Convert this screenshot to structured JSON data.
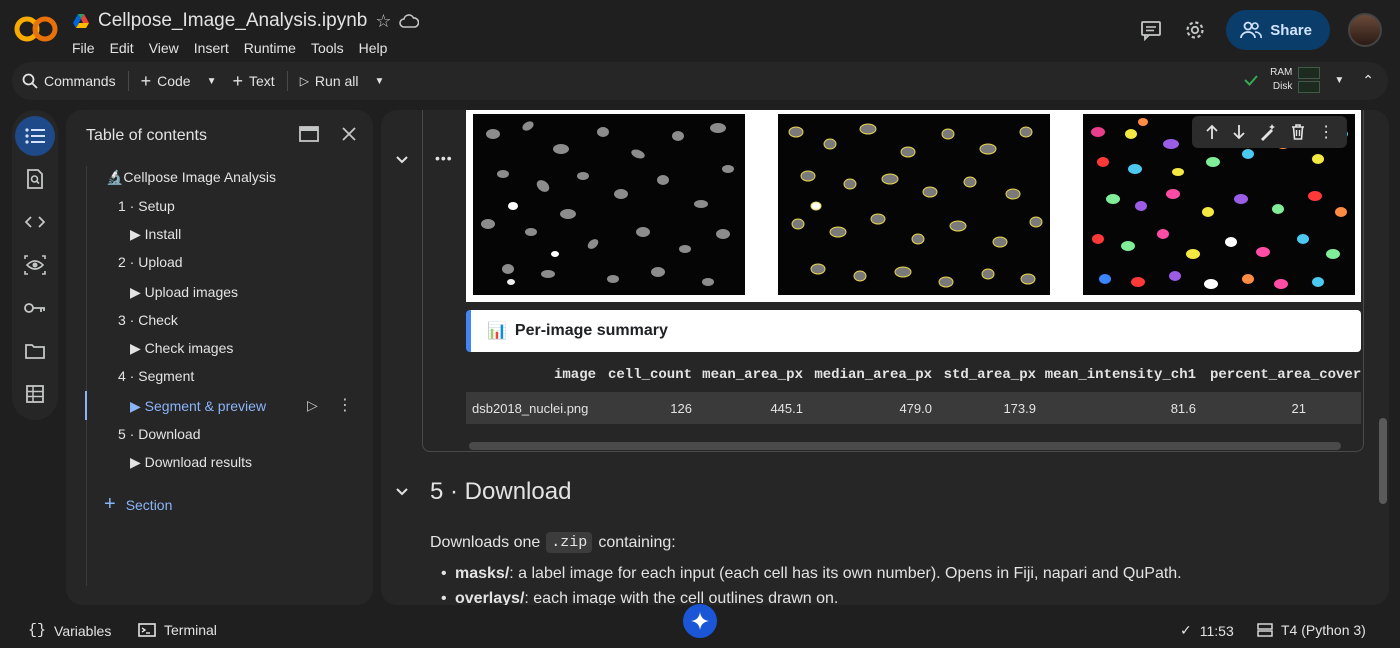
{
  "header": {
    "notebook_title": "Cellpose_Image_Analysis.ipynb",
    "menu": [
      "File",
      "Edit",
      "View",
      "Insert",
      "Runtime",
      "Tools",
      "Help"
    ],
    "share_label": "Share"
  },
  "toolbar": {
    "commands_label": "Commands",
    "code_label": "Code",
    "text_label": "Text",
    "run_all_label": "Run all",
    "ram_label": "RAM",
    "disk_label": "Disk"
  },
  "toc": {
    "title": "Table of contents",
    "items": [
      {
        "label": "🔬Cellpose Image Analysis",
        "level": 0
      },
      {
        "label": "1 · Setup",
        "level": 1
      },
      {
        "label": "▶ Install",
        "level": 2
      },
      {
        "label": "2 · Upload",
        "level": 1
      },
      {
        "label": "▶ Upload images",
        "level": 2
      },
      {
        "label": "3 · Check",
        "level": 1
      },
      {
        "label": "▶ Check images",
        "level": 2
      },
      {
        "label": "4 · Segment",
        "level": 1
      },
      {
        "label": "▶ Segment & preview",
        "level": 2,
        "active": true
      },
      {
        "label": "5 · Download",
        "level": 1
      },
      {
        "label": "▶ Download results",
        "level": 2
      }
    ],
    "add_section_label": "Section"
  },
  "output": {
    "summary_title": "Per-image summary",
    "summary_emoji": "📊",
    "table": {
      "columns": [
        "image",
        "cell_count",
        "mean_area_px",
        "median_area_px",
        "std_area_px",
        "mean_intensity_ch1",
        "percent_area_covere"
      ],
      "rows": [
        [
          "dsb2018_nuclei.png",
          "126",
          "445.1",
          "479.0",
          "173.9",
          "81.6",
          "21"
        ]
      ]
    }
  },
  "markdown": {
    "heading": "5 · Download",
    "intro_before": "Downloads one",
    "intro_code": ".zip",
    "intro_after": "containing:",
    "bullets": [
      {
        "bold": "masks/",
        "text": ": a label image for each input (each cell has its own number). Opens in Fiji, napari and QuPath."
      },
      {
        "bold": "overlays/",
        "text": ": each image with the cell outlines drawn on."
      }
    ]
  },
  "statusbar": {
    "variables_label": "Variables",
    "terminal_label": "Terminal",
    "time": "11:53",
    "runtime": "T4 (Python 3)"
  },
  "colors": {
    "accent": "#8ab4f8",
    "share_bg": "#0b3d6b",
    "gemini": "#1a56d6"
  }
}
